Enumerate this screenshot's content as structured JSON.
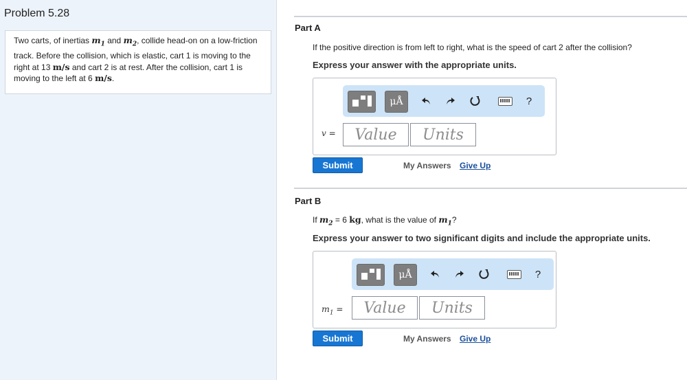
{
  "problem": {
    "title": "Problem 5.28",
    "text": {
      "t1": "Two carts, of inertias ",
      "m": "m",
      "sub1": "1",
      "t2": " and ",
      "sub2": "2",
      "t3": ", collide head-on on a low-friction track. Before the collision, which is elastic, cart 1 is moving to the right at 13 ",
      "unit": "m/s",
      "t4": " and cart 2 is at rest. After the collision, cart 1 is moving to the left at 6 ",
      "t5": "."
    }
  },
  "partA": {
    "title": "Part A",
    "question": "If the positive direction is from left to right, what is the speed of cart 2 after the collision?",
    "instruction": "Express your answer with the appropriate units.",
    "var_label": "v =",
    "value_placeholder": "Value",
    "units_placeholder": "Units",
    "submit": "Submit",
    "my_answers": "My Answers",
    "give_up": "Give Up"
  },
  "partB": {
    "title": "Part B",
    "q_if": "If ",
    "q_m": "m",
    "q_sub2": "2",
    "q_eq": " = 6 ",
    "q_kg": "kg",
    "q_rest": ", what is the value of ",
    "q_sub1": "1",
    "q_end": "?",
    "instruction": "Express your answer to two significant digits and include the appropriate units.",
    "var_m": "m",
    "var_sub": "1",
    "var_eq": " =",
    "value_placeholder": "Value",
    "units_placeholder": "Units",
    "submit": "Submit",
    "my_answers": "My Answers",
    "give_up": "Give Up"
  },
  "toolbar": {
    "units_label": "μÅ",
    "help_label": "?",
    "icons": [
      "templates-icon",
      "units-icon",
      "undo-icon",
      "redo-icon",
      "reset-icon",
      "keyboard-icon",
      "help-icon"
    ]
  },
  "colors": {
    "left_panel_bg": "#edf3fb",
    "toolbar_bg": "#cde3f7",
    "submit_bg": "#1876d3",
    "link": "#1a4f9c"
  }
}
